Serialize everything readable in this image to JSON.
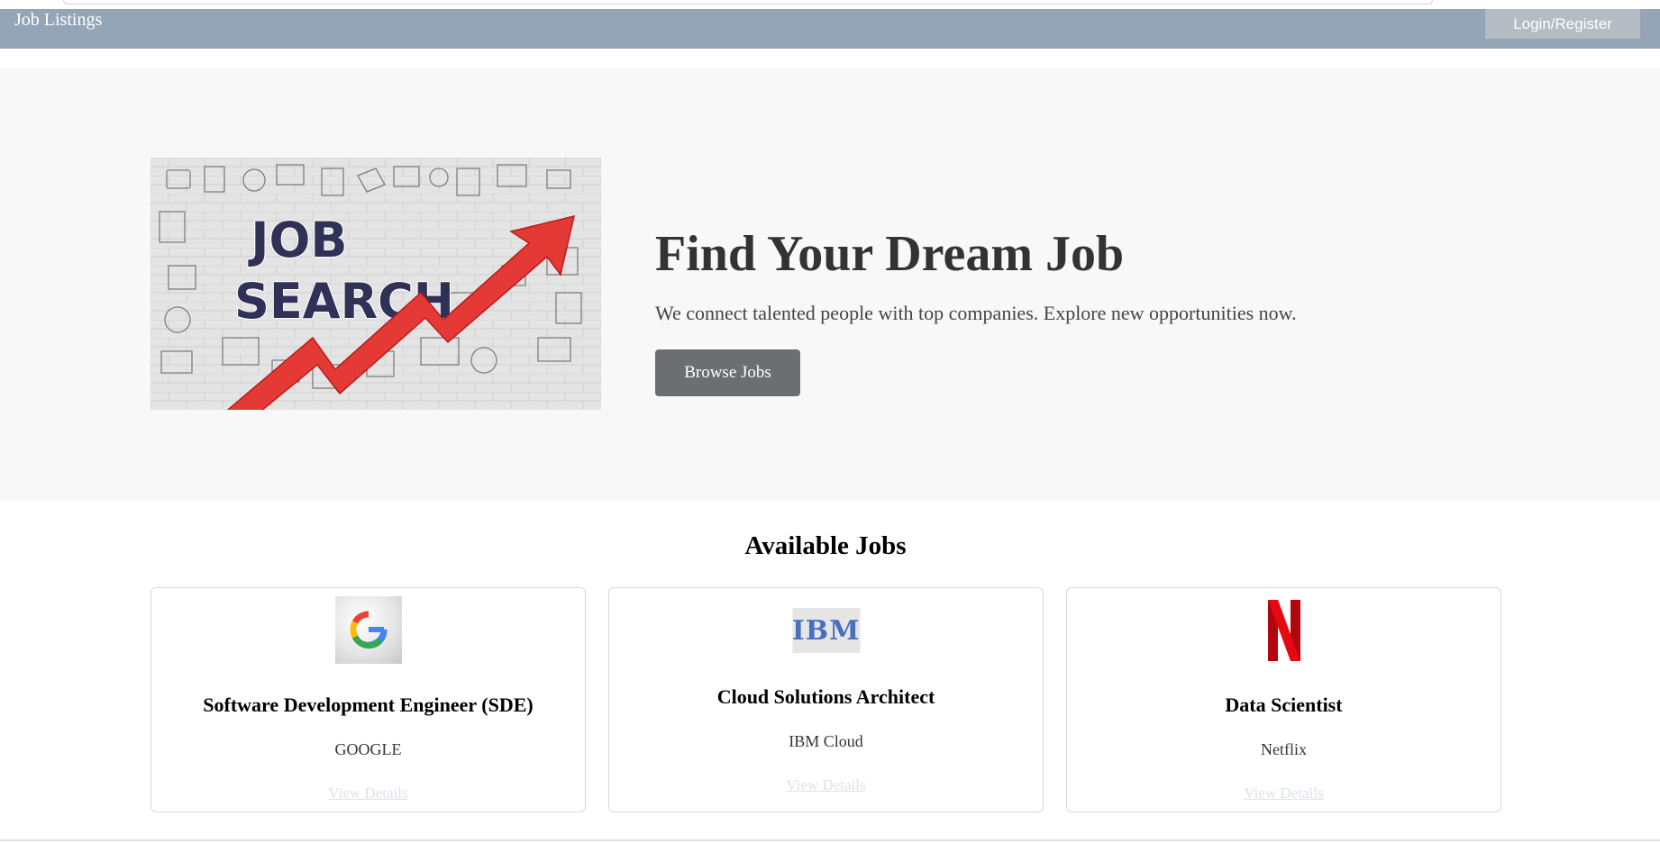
{
  "navbar": {
    "brand": "Job Listings",
    "login_label": "Login/Register"
  },
  "hero": {
    "image_text_line1": "JOB",
    "image_text_line2": "SEARCH",
    "title": "Find Your Dream Job",
    "subtitle": "We connect talented people with top companies. Explore new opportunities now.",
    "button_label": "Browse Jobs"
  },
  "jobs": {
    "section_title": "Available Jobs",
    "items": [
      {
        "logo": "google-logo",
        "title": "Software Development Engineer (SDE)",
        "company": "GOOGLE",
        "link_label": "View Details"
      },
      {
        "logo": "ibm-logo",
        "logo_text": "IBM",
        "title": "Cloud Solutions Architect",
        "company": "IBM Cloud",
        "link_label": "View Details"
      },
      {
        "logo": "netflix-logo",
        "title": "Data Scientist",
        "company": "Netflix",
        "link_label": "View Details"
      }
    ]
  },
  "colors": {
    "navbar": "#94a5b7",
    "hero_background": "#f8f8f8",
    "button": "#6c6f71",
    "arrow": "#e53935"
  }
}
